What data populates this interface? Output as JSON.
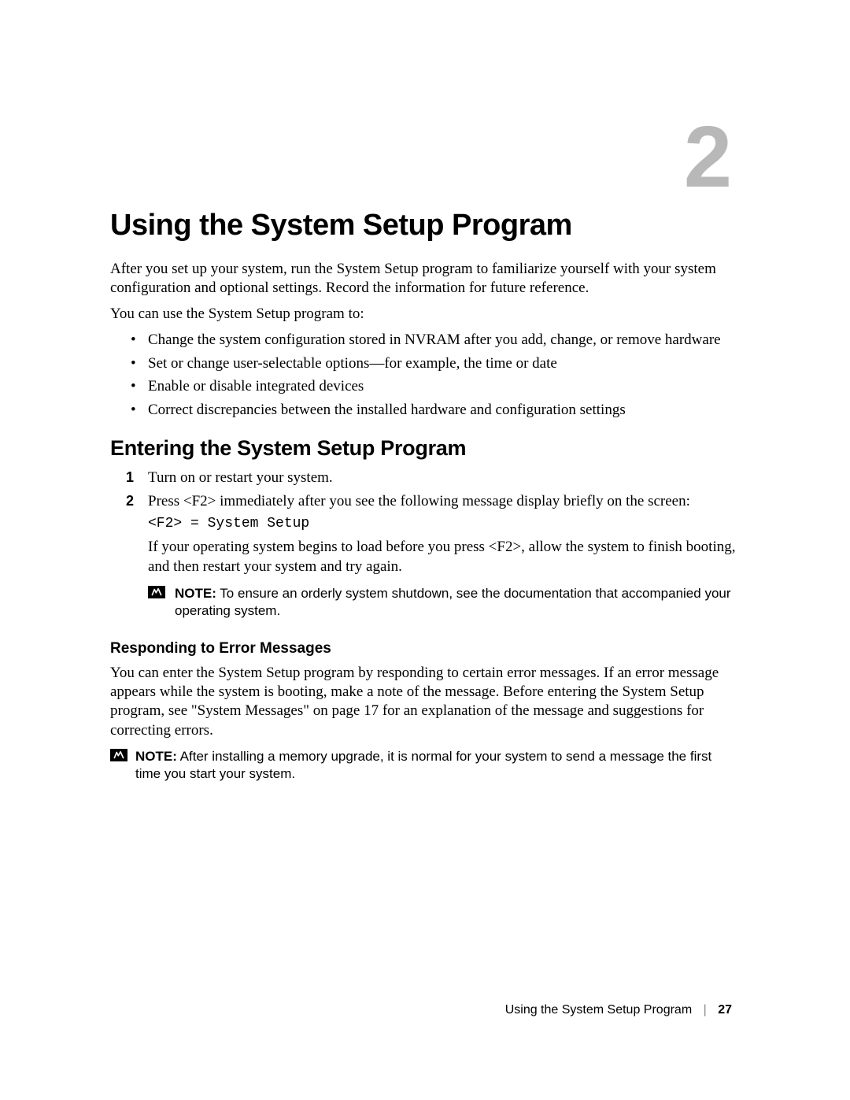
{
  "chapter_number": "2",
  "chapter_title": "Using the System Setup Program",
  "intro_para1": "After you set up your system, run the System Setup program to familiarize yourself with your system configuration and optional settings. Record the information for future reference.",
  "intro_para2": "You can use the System Setup program to:",
  "bullets": {
    "b1": "Change the system configuration stored in NVRAM after you add, change, or remove hardware",
    "b2": "Set or change user-selectable options—for example, the time or date",
    "b3": "Enable or disable integrated devices",
    "b4": "Correct discrepancies between the installed hardware and configuration settings"
  },
  "section_title": "Entering the System Setup Program",
  "steps": {
    "s1": "Turn on or restart your system.",
    "s2": "Press <F2> immediately after you see the following message display briefly on the screen:",
    "s2_code": "<F2> = System Setup",
    "s2_follow": "If your operating system begins to load before you press <F2>, allow the system to finish booting, and then restart your system and try again."
  },
  "note1_label": "NOTE:",
  "note1_text": " To ensure an orderly system shutdown, see the documentation that accompanied your operating system.",
  "subsection_title": "Responding to Error Messages",
  "error_para": "You can enter the System Setup program by responding to certain error messages. If an error message appears while the system is booting, make a note of the message. Before entering the System Setup program, see \"System Messages\" on page 17 for an explanation of the message and suggestions for correcting errors.",
  "note2_label": "NOTE:",
  "note2_text": " After installing a memory upgrade, it is normal for your system to send a message the first time you start your system.",
  "footer_title": "Using the System Setup Program",
  "footer_sep": "|",
  "footer_page": "27"
}
